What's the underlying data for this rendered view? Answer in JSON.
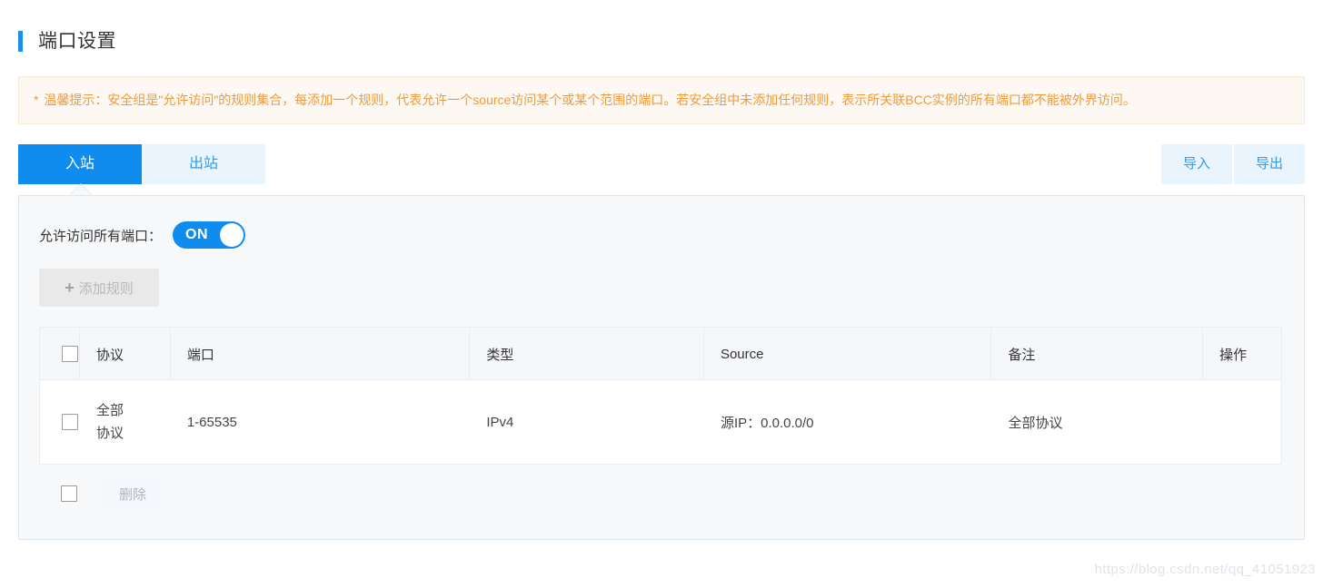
{
  "header": {
    "title": "端口设置"
  },
  "tip": {
    "marker": "*",
    "text": "温馨提示：安全组是\"允许访问\"的规则集合，每添加一个规则，代表允许一个source访问某个或某个范围的端口。若安全组中未添加任何规则，表示所关联BCC实例的所有端口都不能被外界访问。"
  },
  "tabs": [
    {
      "label": "入站",
      "active": true
    },
    {
      "label": "出站",
      "active": false
    }
  ],
  "toolbar": {
    "import_label": "导入",
    "export_label": "导出"
  },
  "panel": {
    "toggle_label": "允许访问所有端口：",
    "toggle_state": "ON",
    "add_rule_label": "添加规则",
    "add_rule_icon": "plus-icon"
  },
  "table": {
    "columns": [
      "协议",
      "端口",
      "类型",
      "Source",
      "备注",
      "操作"
    ],
    "rows": [
      {
        "protocol": "全部协议",
        "port": "1-65535",
        "type": "IPv4",
        "source": "源IP：0.0.0.0/0",
        "remark": "全部协议",
        "action": ""
      }
    ],
    "footer": {
      "delete_label": "删除"
    }
  },
  "watermark": "https://blog.csdn.net/qq_41051923",
  "colors": {
    "accent": "#108cee",
    "tab_inactive_bg": "#eaf4fd",
    "tip_text": "#ef9a3d",
    "tip_bg": "#fdf8f2",
    "panel_bg": "#f7f8fa"
  }
}
